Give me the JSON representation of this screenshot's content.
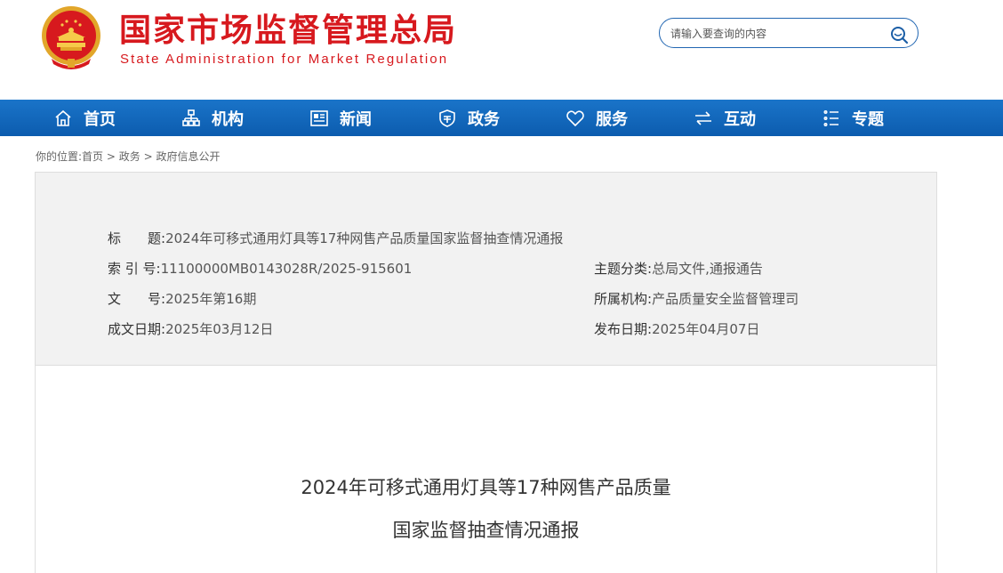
{
  "header": {
    "title_cn": "国家市场监督管理总局",
    "title_en": "State Administration for Market Regulation",
    "emblem_icon": "national-emblem-icon"
  },
  "search": {
    "placeholder": "请输入要查询的内容",
    "icon": "search-icon"
  },
  "nav": {
    "items": [
      {
        "label": "首页",
        "icon": "home-icon"
      },
      {
        "label": "机构",
        "icon": "org-chart-icon"
      },
      {
        "label": "新闻",
        "icon": "news-icon"
      },
      {
        "label": "政务",
        "icon": "shield-icon"
      },
      {
        "label": "服务",
        "icon": "heart-icon"
      },
      {
        "label": "互动",
        "icon": "exchange-arrows-icon"
      },
      {
        "label": "专题",
        "icon": "list-icon"
      }
    ]
  },
  "breadcrumb": {
    "prefix": "你的位置:",
    "items": [
      "首页",
      "政务",
      "政府信息公开"
    ],
    "separator": ">"
  },
  "meta": {
    "title_label": "标　　题:",
    "title_value": "2024年可移式通用灯具等17种网售产品质量国家监督抽查情况通报",
    "index_label": "索 引 号:",
    "index_value": "11100000MB0143028R/2025-915601",
    "category_label": "主题分类:",
    "category_value": "总局文件,通报通告",
    "docno_label": "文　　号:",
    "docno_value": "2025年第16期",
    "org_label": "所属机构:",
    "org_value": "产品质量安全监督管理司",
    "written_label": "成文日期:",
    "written_value": "2025年03月12日",
    "published_label": "发布日期:",
    "published_value": "2025年04月07日"
  },
  "document": {
    "title_line1": "2024年可移式通用灯具等17种网售产品质量",
    "title_line2": "国家监督抽查情况通报"
  },
  "colors": {
    "brand_red": "#d7191e",
    "nav_blue": "#1a74c9",
    "meta_bg": "#f2f2f2"
  }
}
